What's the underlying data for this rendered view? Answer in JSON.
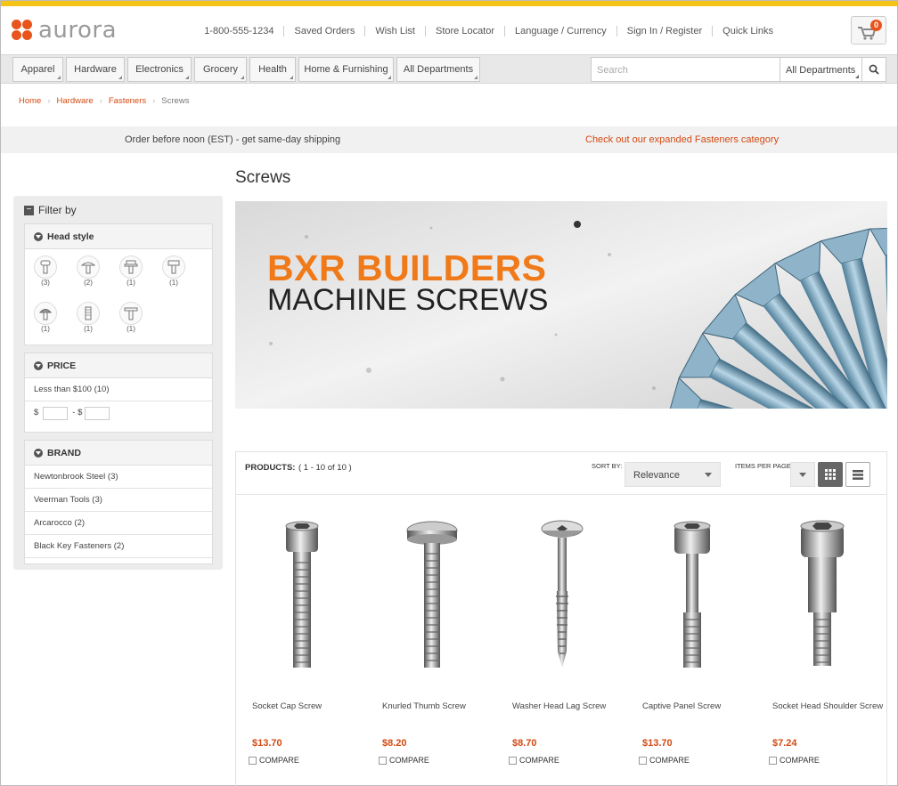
{
  "header": {
    "logo_text": "aurora",
    "phone": "1-800-555-1234",
    "links": [
      "Saved Orders",
      "Wish List",
      "Store Locator",
      "Language / Currency",
      "Sign In / Register",
      "Quick Links"
    ],
    "cart_count": "0"
  },
  "nav": {
    "departments": [
      "Apparel",
      "Hardware",
      "Electronics",
      "Grocery",
      "Health",
      "Home & Furnishing",
      "All Departments"
    ],
    "search_placeholder": "Search",
    "search_scope": "All Departments"
  },
  "breadcrumb": [
    "Home",
    "Hardware",
    "Fasteners",
    "Screws"
  ],
  "promo": {
    "left": "Order before noon (EST) - get same-day shipping",
    "right": "Check out our expanded Fasteners category"
  },
  "page_title": "Screws",
  "filters": {
    "title": "Filter by",
    "head_style": {
      "title": "Head style",
      "counts": [
        "(3)",
        "(2)",
        "(1)",
        "(1)",
        "(1)",
        "(1)",
        "(1)"
      ]
    },
    "price": {
      "title": "PRICE",
      "option": "Less than $100 (10)",
      "currency": "$",
      "range_sep": "- $"
    },
    "brand": {
      "title": "BRAND",
      "options": [
        "Newtonbrook Steel (3)",
        "Veerman Tools (3)",
        "Arcarocco (2)",
        "Black Key Fasteners (2)"
      ]
    }
  },
  "banner": {
    "line1": "BXR BUILDERS",
    "line2": "MACHINE SCREWS"
  },
  "products_bar": {
    "label": "PRODUCTS:",
    "range": "( 1 - 10 of 10 )",
    "sort_label": "SORT BY:",
    "sort_value": "Relevance",
    "items_label": "ITEMS PER PAGE:"
  },
  "products": [
    {
      "name": "Socket Cap Screw",
      "price": "$13.70",
      "compare": "COMPARE"
    },
    {
      "name": "Knurled Thumb Screw",
      "price": "$8.20",
      "compare": "COMPARE"
    },
    {
      "name": "Washer Head Lag Screw",
      "price": "$8.70",
      "compare": "COMPARE"
    },
    {
      "name": "Captive Panel Screw",
      "price": "$13.70",
      "compare": "COMPARE"
    },
    {
      "name": "Socket Head Shoulder Screw",
      "price": "$7.24",
      "compare": "COMPARE"
    }
  ],
  "colors": {
    "accent": "#e8541c",
    "top_bar": "#f6c317",
    "banner_title": "#f07a1a"
  }
}
